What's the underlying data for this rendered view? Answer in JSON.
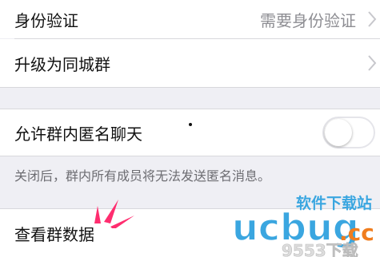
{
  "settings": {
    "identity_verification": {
      "label": "身份验证",
      "value": "需要身份验证"
    },
    "upgrade_city_group": {
      "label": "升级为同城群"
    },
    "anonymous_chat": {
      "label": "允许群内匿名聊天",
      "enabled": false
    },
    "anonymous_note": "关闭后，群内所有成员将无法发送匿名消息。",
    "view_group_data": {
      "label": "查看群数据"
    }
  },
  "watermark": {
    "brand": "ucbug",
    "suffix": ".cc",
    "tagline": "软件下载站",
    "sub": "9553下载",
    "brand_color": "#3aa6e0",
    "accent_color": "#f07d1e"
  },
  "colors": {
    "page_bg": "#efeff4",
    "row_bg": "#ffffff",
    "divider": "#d8d8dc",
    "annotation_red": "#ff2d6f"
  }
}
